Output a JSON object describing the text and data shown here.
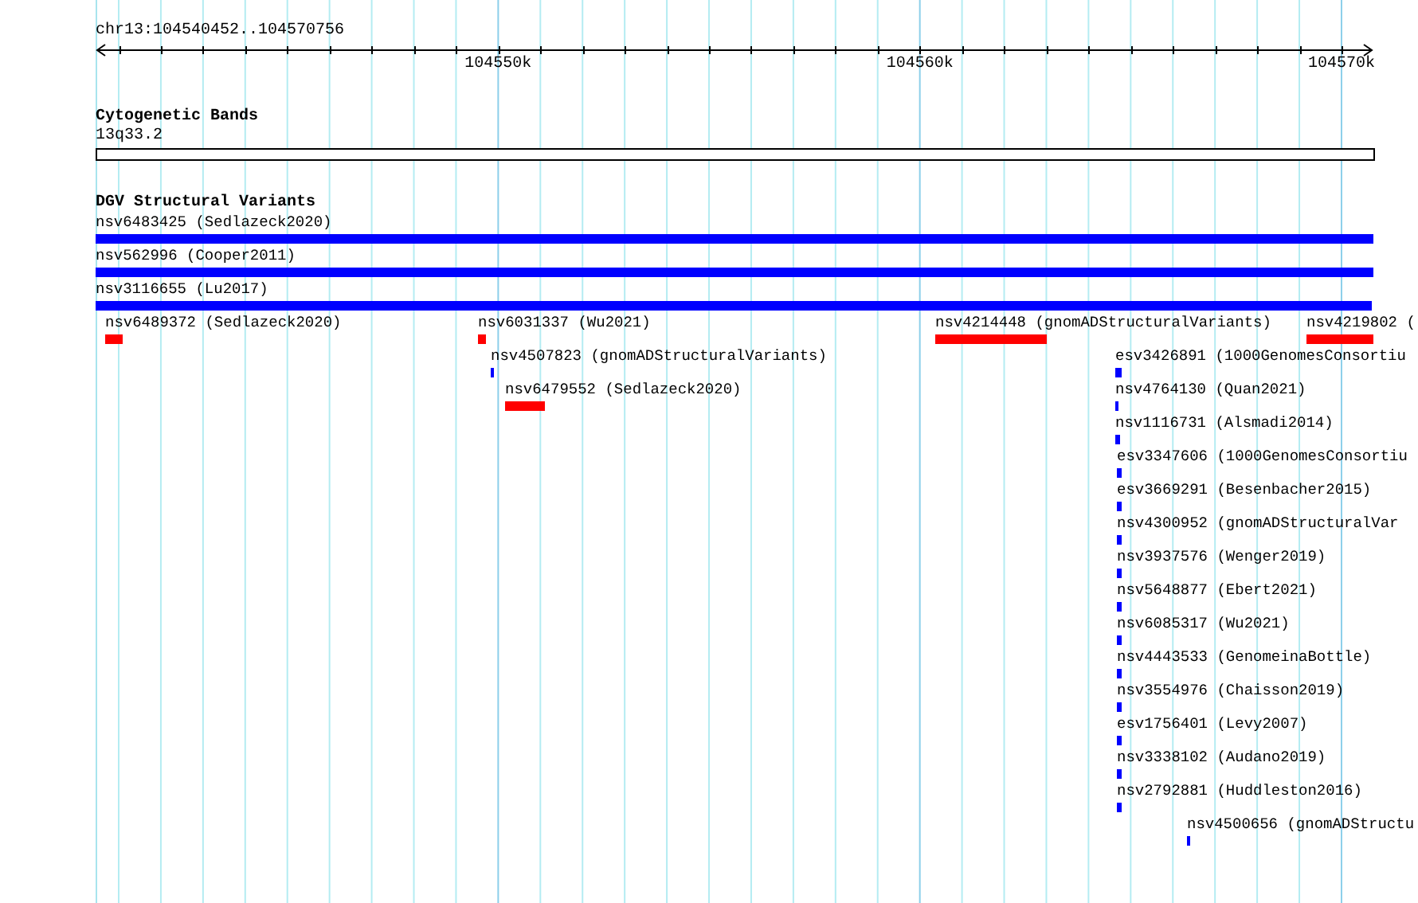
{
  "ruler": {
    "location": "chr13:104540452..104570756",
    "tick_labels": [
      "104550k",
      "104560k",
      "104570k"
    ]
  },
  "cytogenetic_bands": {
    "title": "Cytogenetic Bands",
    "band_label": "13q33.2"
  },
  "dgv_structural_variants": {
    "title": "DGV Structural Variants",
    "features": [
      {
        "label": "nsv6483425 (Sedlazeck2020)",
        "color": "#0000ff"
      },
      {
        "label": "nsv562996 (Cooper2011)",
        "color": "#0000ff"
      },
      {
        "label": "nsv3116655 (Lu2017)",
        "color": "#0000ff"
      },
      {
        "label": "nsv6489372 (Sedlazeck2020)",
        "color": "#ff0000"
      },
      {
        "label": "nsv6031337 (Wu2021)",
        "color": "#ff0000"
      },
      {
        "label": "nsv4214448 (gnomADStructuralVariants)",
        "color": "#ff0000"
      },
      {
        "label": "nsv4219802 (",
        "color": "#ff0000"
      },
      {
        "label": "nsv4507823 (gnomADStructuralVariants)",
        "color": "#0000ff"
      },
      {
        "label": "esv3426891 (1000GenomesConsortiu",
        "color": "#0000ff"
      },
      {
        "label": "nsv6479552 (Sedlazeck2020)",
        "color": "#ff0000"
      },
      {
        "label": "nsv4764130 (Quan2021)",
        "color": "#0000ff"
      },
      {
        "label": "nsv1116731 (Alsmadi2014)",
        "color": "#0000ff"
      },
      {
        "label": "esv3347606 (1000GenomesConsortiu",
        "color": "#0000ff"
      },
      {
        "label": "esv3669291 (Besenbacher2015)",
        "color": "#0000ff"
      },
      {
        "label": "nsv4300952 (gnomADStructuralVar",
        "color": "#0000ff"
      },
      {
        "label": "nsv3937576 (Wenger2019)",
        "color": "#0000ff"
      },
      {
        "label": "nsv5648877 (Ebert2021)",
        "color": "#0000ff"
      },
      {
        "label": "nsv6085317 (Wu2021)",
        "color": "#0000ff"
      },
      {
        "label": "nsv4443533 (GenomeinaBottle)",
        "color": "#0000ff"
      },
      {
        "label": "nsv3554976 (Chaisson2019)",
        "color": "#0000ff"
      },
      {
        "label": "esv1756401 (Levy2007)",
        "color": "#0000ff"
      },
      {
        "label": "nsv3338102 (Audano2019)",
        "color": "#0000ff"
      },
      {
        "label": "nsv2792881 (Huddleston2016)",
        "color": "#0000ff"
      },
      {
        "label": "nsv4500656 (gnomADStructu",
        "color": "#0000ff"
      }
    ]
  }
}
